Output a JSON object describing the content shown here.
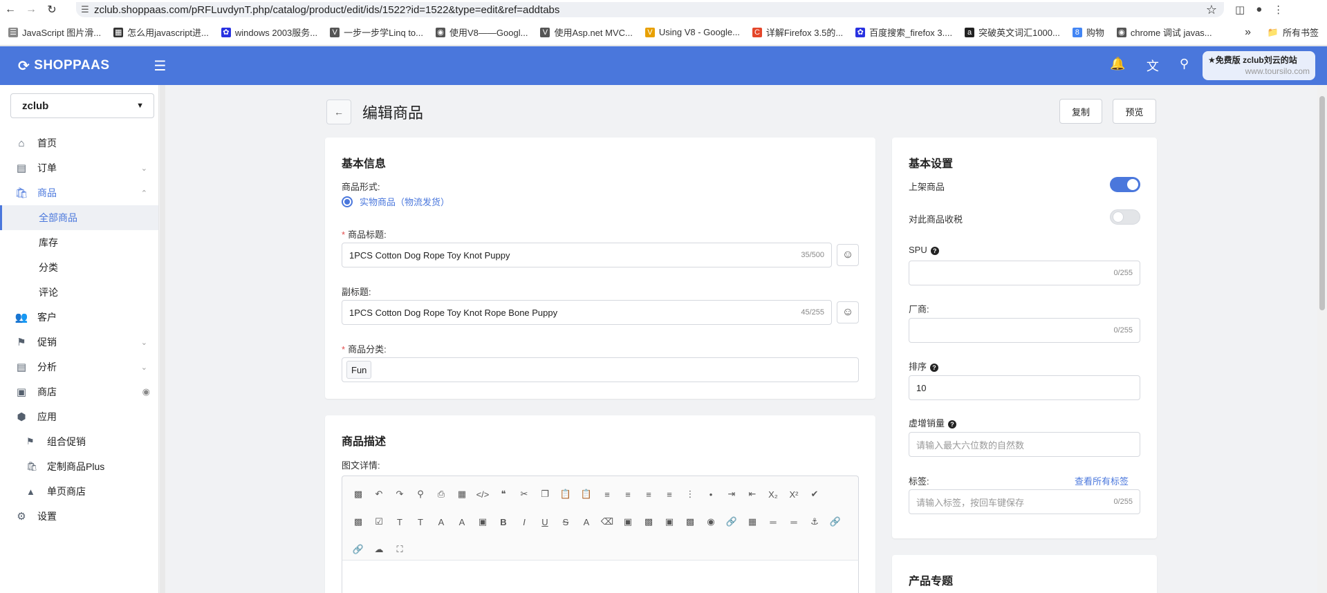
{
  "browser": {
    "url": "zclub.shoppaas.com/pRFLuvdynT.php/catalog/product/edit/ids/1522?id=1522&type=edit&ref=addtabs",
    "bookmarks": [
      {
        "label": "JavaScript 图片滑...",
        "icon": "bookmark-doc-icon"
      },
      {
        "label": "怎么用javascript进...",
        "icon": "bookmark-img-icon"
      },
      {
        "label": "windows 2003服务...",
        "icon": "baidu-paw-icon"
      },
      {
        "label": "一步一步学Linq to...",
        "icon": "bookmark-v-icon"
      },
      {
        "label": "使用V8——Googl...",
        "icon": "globe-icon"
      },
      {
        "label": "使用Asp.net MVC...",
        "icon": "bookmark-v-icon"
      },
      {
        "label": "Using V8 - Google...",
        "icon": "v8-icon"
      },
      {
        "label": "详解Firefox 3.5的...",
        "icon": "c-red-icon"
      },
      {
        "label": "百度搜索_firefox 3....",
        "icon": "baidu-paw-icon"
      },
      {
        "label": "突破英文词汇1000...",
        "icon": "amazon-icon"
      },
      {
        "label": "购物",
        "icon": "google-g-icon"
      },
      {
        "label": "chrome 调试 javas...",
        "icon": "globe-icon"
      }
    ],
    "all_bookmarks": "所有书签"
  },
  "header": {
    "logo": "SHOPPAAS",
    "promo_title": "★免费版 zclub刘云的站",
    "promo_sub": "www.toursilo.com"
  },
  "sidebar": {
    "store": "zclub",
    "items": {
      "home": "首页",
      "orders": "订单",
      "products": "商品",
      "all_products": "全部商品",
      "inventory": "库存",
      "categories": "分类",
      "reviews": "评论",
      "customers": "客户",
      "promotions": "促销",
      "analytics": "分析",
      "store": "商店",
      "apps": "应用",
      "bundle_promo": "组合促销",
      "custom_product": "定制商品Plus",
      "single_page": "单页商店",
      "settings": "设置"
    }
  },
  "page": {
    "title": "编辑商品",
    "copy_btn": "复制",
    "preview_btn": "预览"
  },
  "basic_info": {
    "title": "基本信息",
    "form_label": "商品形式:",
    "form_value": "实物商品（物流发货）",
    "product_title_label": "商品标题:",
    "product_title_value": "1PCS Cotton Dog Rope Toy Knot Puppy",
    "product_title_count": "35/500",
    "subtitle_label": "副标题:",
    "subtitle_value": "1PCS Cotton Dog Rope Toy Knot Rope Bone Puppy",
    "subtitle_count": "45/255",
    "category_label": "商品分类:",
    "category_tag": "Fun"
  },
  "description": {
    "title": "商品描述",
    "rich_label": "图文详情:"
  },
  "settings": {
    "title": "基本设置",
    "publish_label": "上架商品",
    "publish_on": true,
    "tax_label": "对此商品收税",
    "tax_on": false,
    "spu_label": "SPU",
    "spu_count": "0/255",
    "vendor_label": "厂商:",
    "vendor_count": "0/255",
    "sort_label": "排序",
    "sort_value": "10",
    "fake_sales_label": "虚增销量",
    "fake_sales_placeholder": "请输入最大六位数的自然数",
    "tags_label": "标签:",
    "tags_link": "查看所有标签",
    "tags_placeholder": "请输入标签，按回车键保存",
    "tags_count": "0/255"
  },
  "topics": {
    "title": "产品专题"
  },
  "colors": {
    "accent": "#4a77dc",
    "required": "#e34d4d"
  }
}
